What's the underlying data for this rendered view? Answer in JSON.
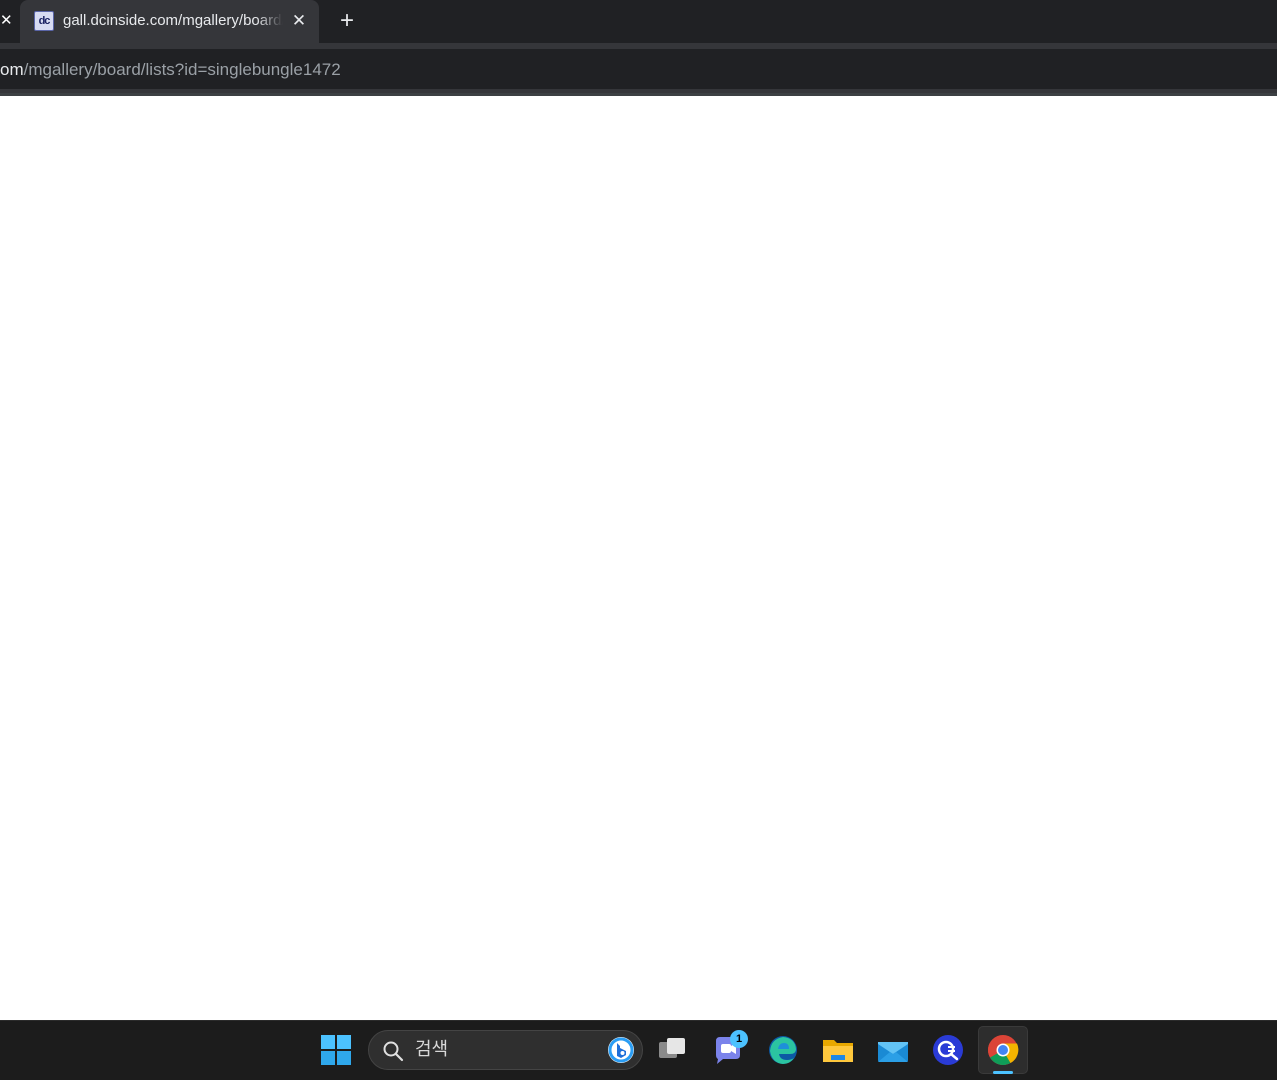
{
  "browser": {
    "previous_tab_close_glyph": "✕",
    "active_tab": {
      "favicon_text": "dc",
      "title": "gall.dcinside.com/mgallery/board/lists",
      "close_glyph": "✕"
    },
    "new_tab_glyph": "+",
    "address_bar": {
      "host_fragment": "om",
      "path": "/mgallery/board/lists?id=singlebungle1472"
    }
  },
  "taskbar": {
    "search_placeholder": "검색",
    "apps": [
      {
        "name": "task-view-icon"
      },
      {
        "name": "teams-chat-icon",
        "badge": "1"
      },
      {
        "name": "edge-icon"
      },
      {
        "name": "file-explorer-icon"
      },
      {
        "name": "mail-icon"
      },
      {
        "name": "copilot-search-icon"
      },
      {
        "name": "chrome-icon",
        "active": true
      }
    ]
  },
  "colors": {
    "tab_strip": "#202124",
    "active_tab": "#35363a",
    "taskbar": "#1c1c1c",
    "accent": "#4cc2ff"
  }
}
